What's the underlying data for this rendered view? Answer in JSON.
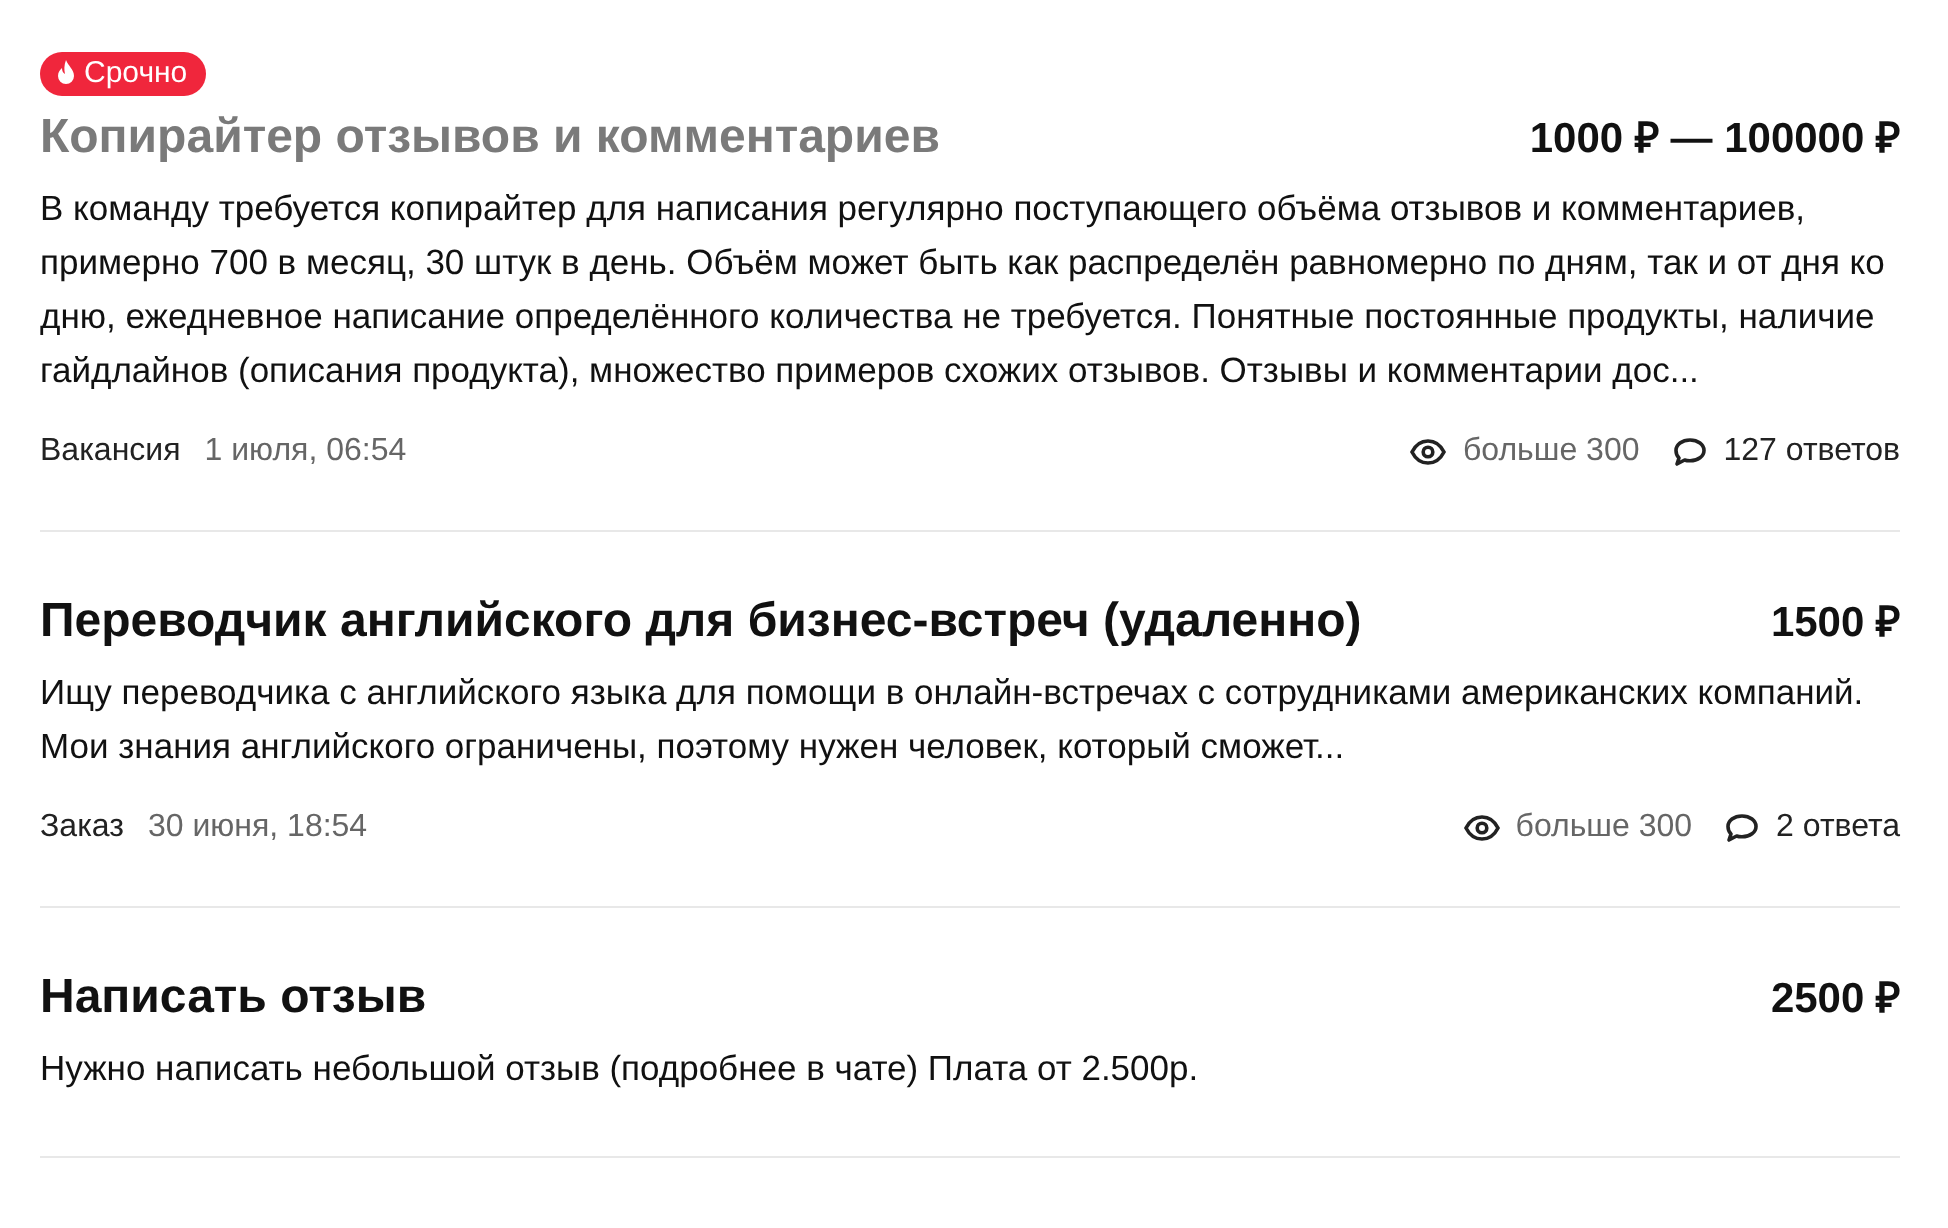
{
  "jobs": [
    {
      "badge": "Срочно",
      "title": "Копирайтер отзывов и комментариев",
      "visited": true,
      "price": "1000 ₽ — 100000 ₽",
      "description": "В команду требуется копирайтер для написания регулярно поступающего объёма отзывов и комментариев, примерно 700 в месяц, 30 штук в день. Объём может быть как распределён равномерно по дням, так и от дня ко дню, ежедневное написание определённого количества не требуется. Понятные постоянные продукты, наличие гайдлайнов (описания продукта), множество примеров схожих отзывов. Отзывы и комментарии дос...",
      "type": "Вакансия",
      "date": "1 июля, 06:54",
      "views": "больше 300",
      "responses": "127 ответов"
    },
    {
      "title": "Переводчик английского для бизнес-встреч (удаленно)",
      "visited": false,
      "price": "1500 ₽",
      "description": "Ищу переводчика с английского языка для помощи в онлайн-встречах с сотрудниками американских компаний. Мои знания английского ограничены, поэтому нужен человек, который сможет...",
      "type": "Заказ",
      "date": "30 июня, 18:54",
      "views": "больше 300",
      "responses": "2 ответа"
    },
    {
      "title": "Написать отзыв",
      "visited": false,
      "price": "2500 ₽",
      "description": "Нужно написать небольшой отзыв (подробнее в чате) Плата от 2.500р."
    }
  ]
}
